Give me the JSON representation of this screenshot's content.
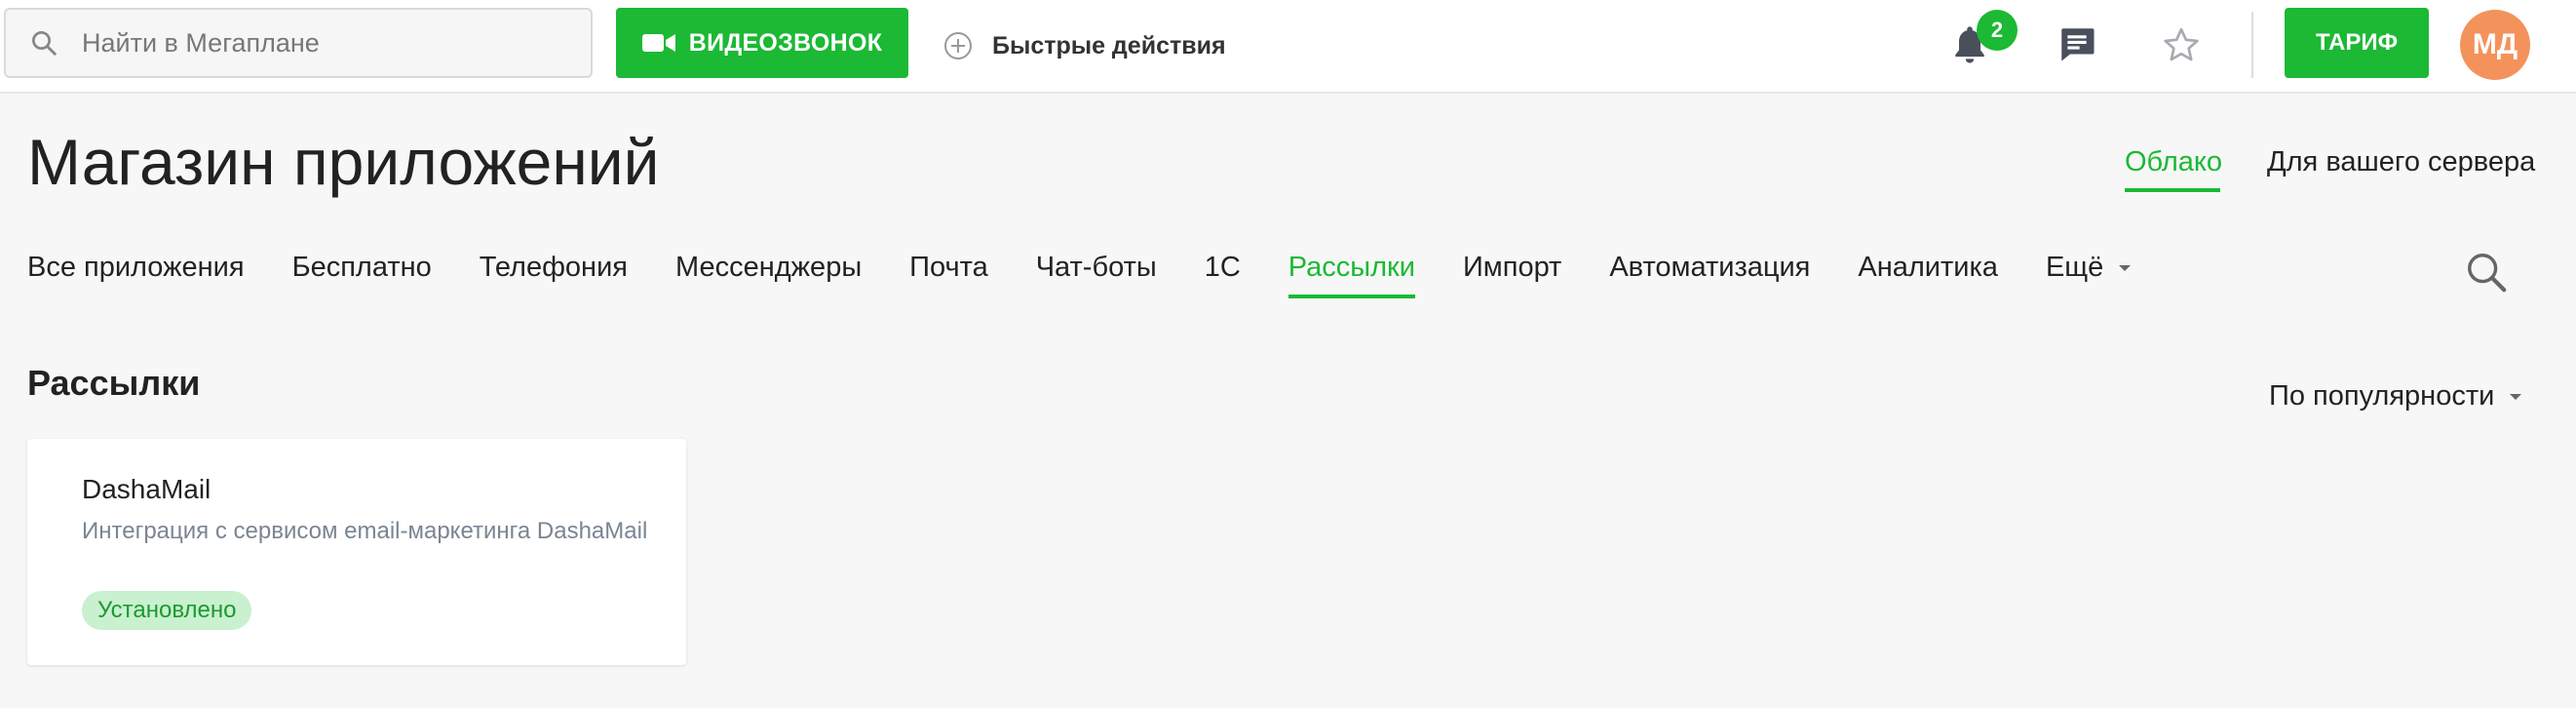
{
  "header": {
    "search_placeholder": "Найти в Мегаплане",
    "video_call_label": "ВИДЕОЗВОНОК",
    "quick_actions_label": "Быстрые действия",
    "notifications_count": "2",
    "tariff_label": "ТАРИФ",
    "avatar_initials": "МД"
  },
  "page": {
    "title": "Магазин приложений",
    "env_tabs": [
      {
        "label": "Облако",
        "active": true
      },
      {
        "label": "Для вашего сервера",
        "active": false
      }
    ]
  },
  "nav": {
    "items": [
      {
        "label": "Все приложения"
      },
      {
        "label": "Бесплатно"
      },
      {
        "label": "Телефония"
      },
      {
        "label": "Мессенджеры"
      },
      {
        "label": "Почта"
      },
      {
        "label": "Чат-боты"
      },
      {
        "label": "1С"
      },
      {
        "label": "Рассылки",
        "active": true
      },
      {
        "label": "Импорт"
      },
      {
        "label": "Автоматизация"
      },
      {
        "label": "Аналитика"
      },
      {
        "label": "Ещё"
      }
    ]
  },
  "section": {
    "title": "Рассылки",
    "sort_label": "По популярности"
  },
  "apps": [
    {
      "title": "DashaMail",
      "description": "Интеграция с сервисом email-маркетинга DashaMail",
      "status": "Установлено"
    }
  ],
  "colors": {
    "accent": "#1bb934",
    "avatar": "#f4925c",
    "badge_bg": "#c9f0cf",
    "page_bg": "#f7f7f7"
  },
  "icons": {
    "search": "search-icon",
    "video": "video-camera-icon",
    "plus": "plus-circle-icon",
    "bell": "bell-icon",
    "chat": "chat-icon",
    "star": "star-icon",
    "caret": "caret-down-icon"
  }
}
